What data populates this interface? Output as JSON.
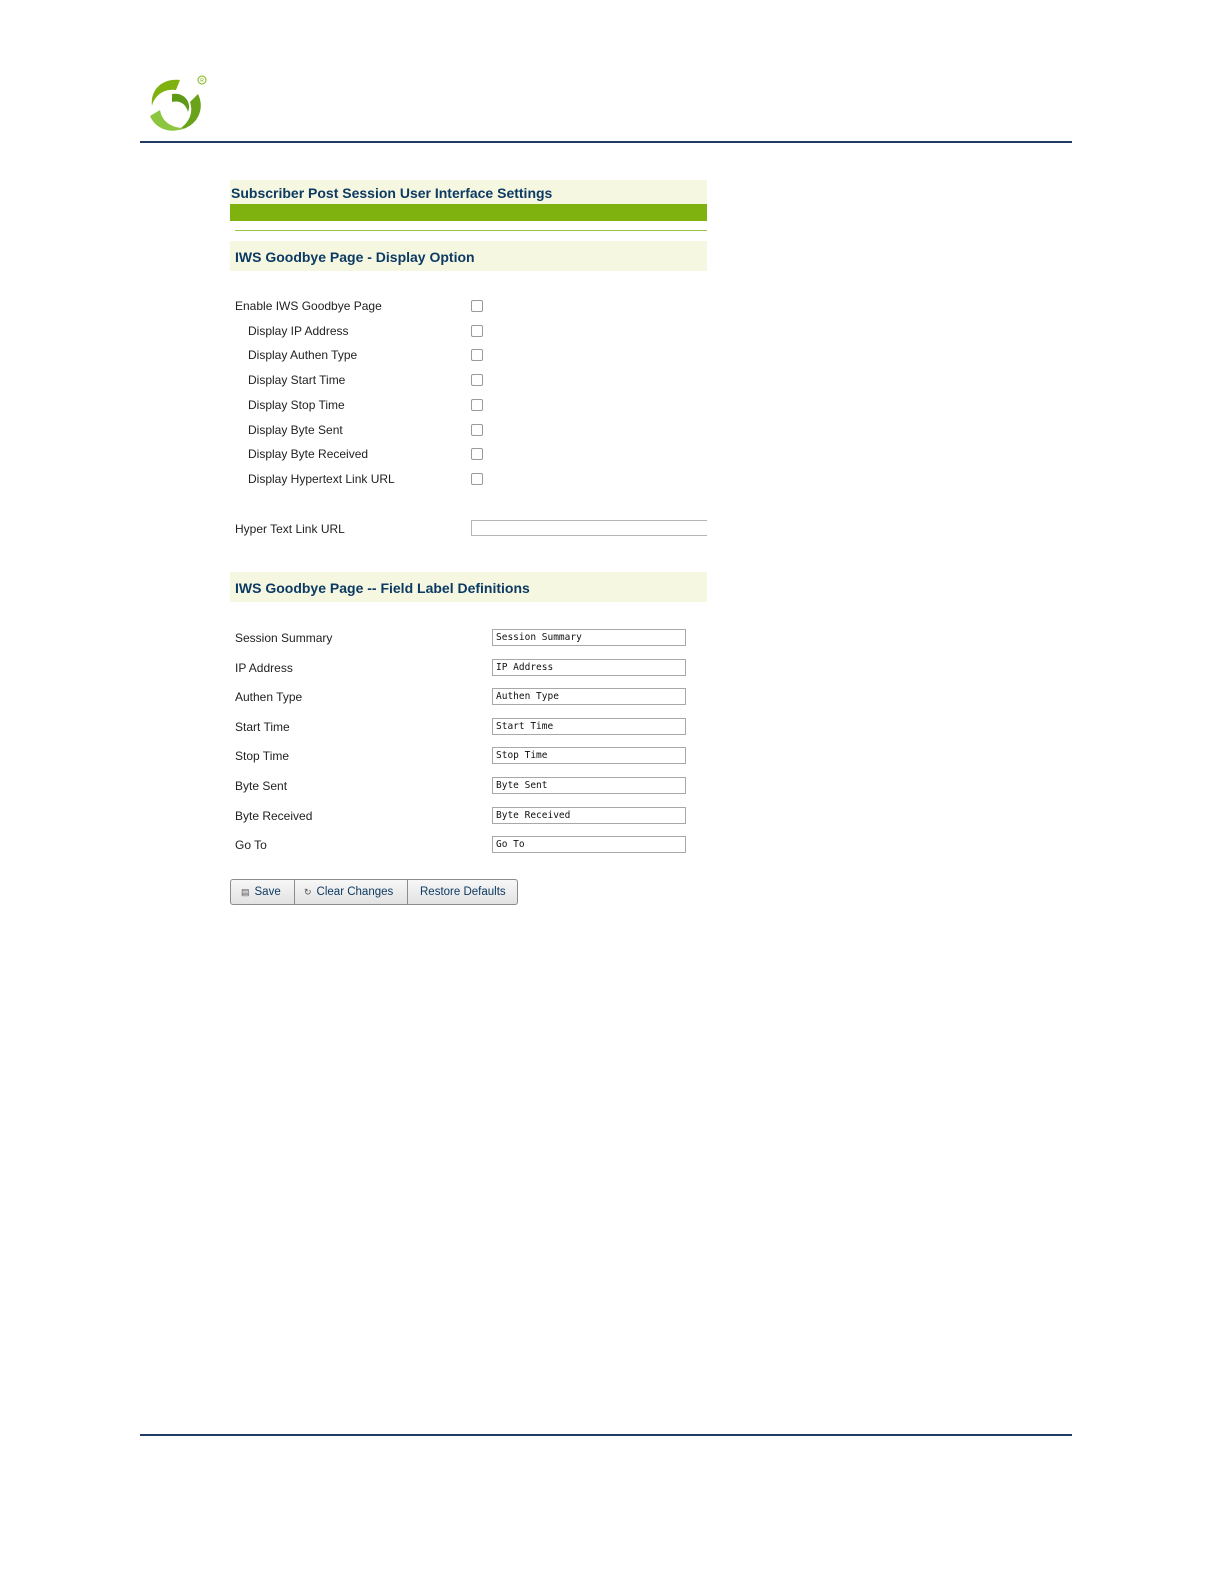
{
  "title": "Subscriber Post Session User Interface Settings",
  "display_section": {
    "heading": "IWS Goodbye Page - Display Option",
    "options": [
      {
        "label": "Enable IWS Goodbye Page",
        "checked": false,
        "indent": false
      },
      {
        "label": "Display IP Address",
        "checked": false,
        "indent": true
      },
      {
        "label": "Display Authen Type",
        "checked": false,
        "indent": true
      },
      {
        "label": "Display Start Time",
        "checked": false,
        "indent": true
      },
      {
        "label": "Display Stop Time",
        "checked": false,
        "indent": true
      },
      {
        "label": "Display Byte Sent",
        "checked": false,
        "indent": true
      },
      {
        "label": "Display Byte Received",
        "checked": false,
        "indent": true
      },
      {
        "label": "Display Hypertext Link URL",
        "checked": false,
        "indent": true
      }
    ],
    "url_label": "Hyper Text Link URL",
    "url_value": ""
  },
  "labels_section": {
    "heading": "IWS Goodbye Page -- Field Label Definitions",
    "fields": [
      {
        "label": "Session Summary",
        "value": "Session Summary"
      },
      {
        "label": "IP Address",
        "value": "IP Address"
      },
      {
        "label": "Authen Type",
        "value": "Authen Type"
      },
      {
        "label": "Start Time",
        "value": "Start Time"
      },
      {
        "label": "Stop Time",
        "value": "Stop Time"
      },
      {
        "label": "Byte Sent",
        "value": "Byte Sent"
      },
      {
        "label": "Byte Received",
        "value": "Byte Received"
      },
      {
        "label": "Go To",
        "value": "Go To"
      }
    ]
  },
  "buttons": {
    "save": "Save",
    "clear": "Clear Changes",
    "restore": "Restore Defaults"
  },
  "icons": {
    "save": "save-icon",
    "clear": "undo-icon"
  },
  "colors": {
    "heading_text": "#0d3a63",
    "section_bg": "#f5f7e1",
    "accent_green": "#7fb20f",
    "rule": "#1f3b66"
  }
}
